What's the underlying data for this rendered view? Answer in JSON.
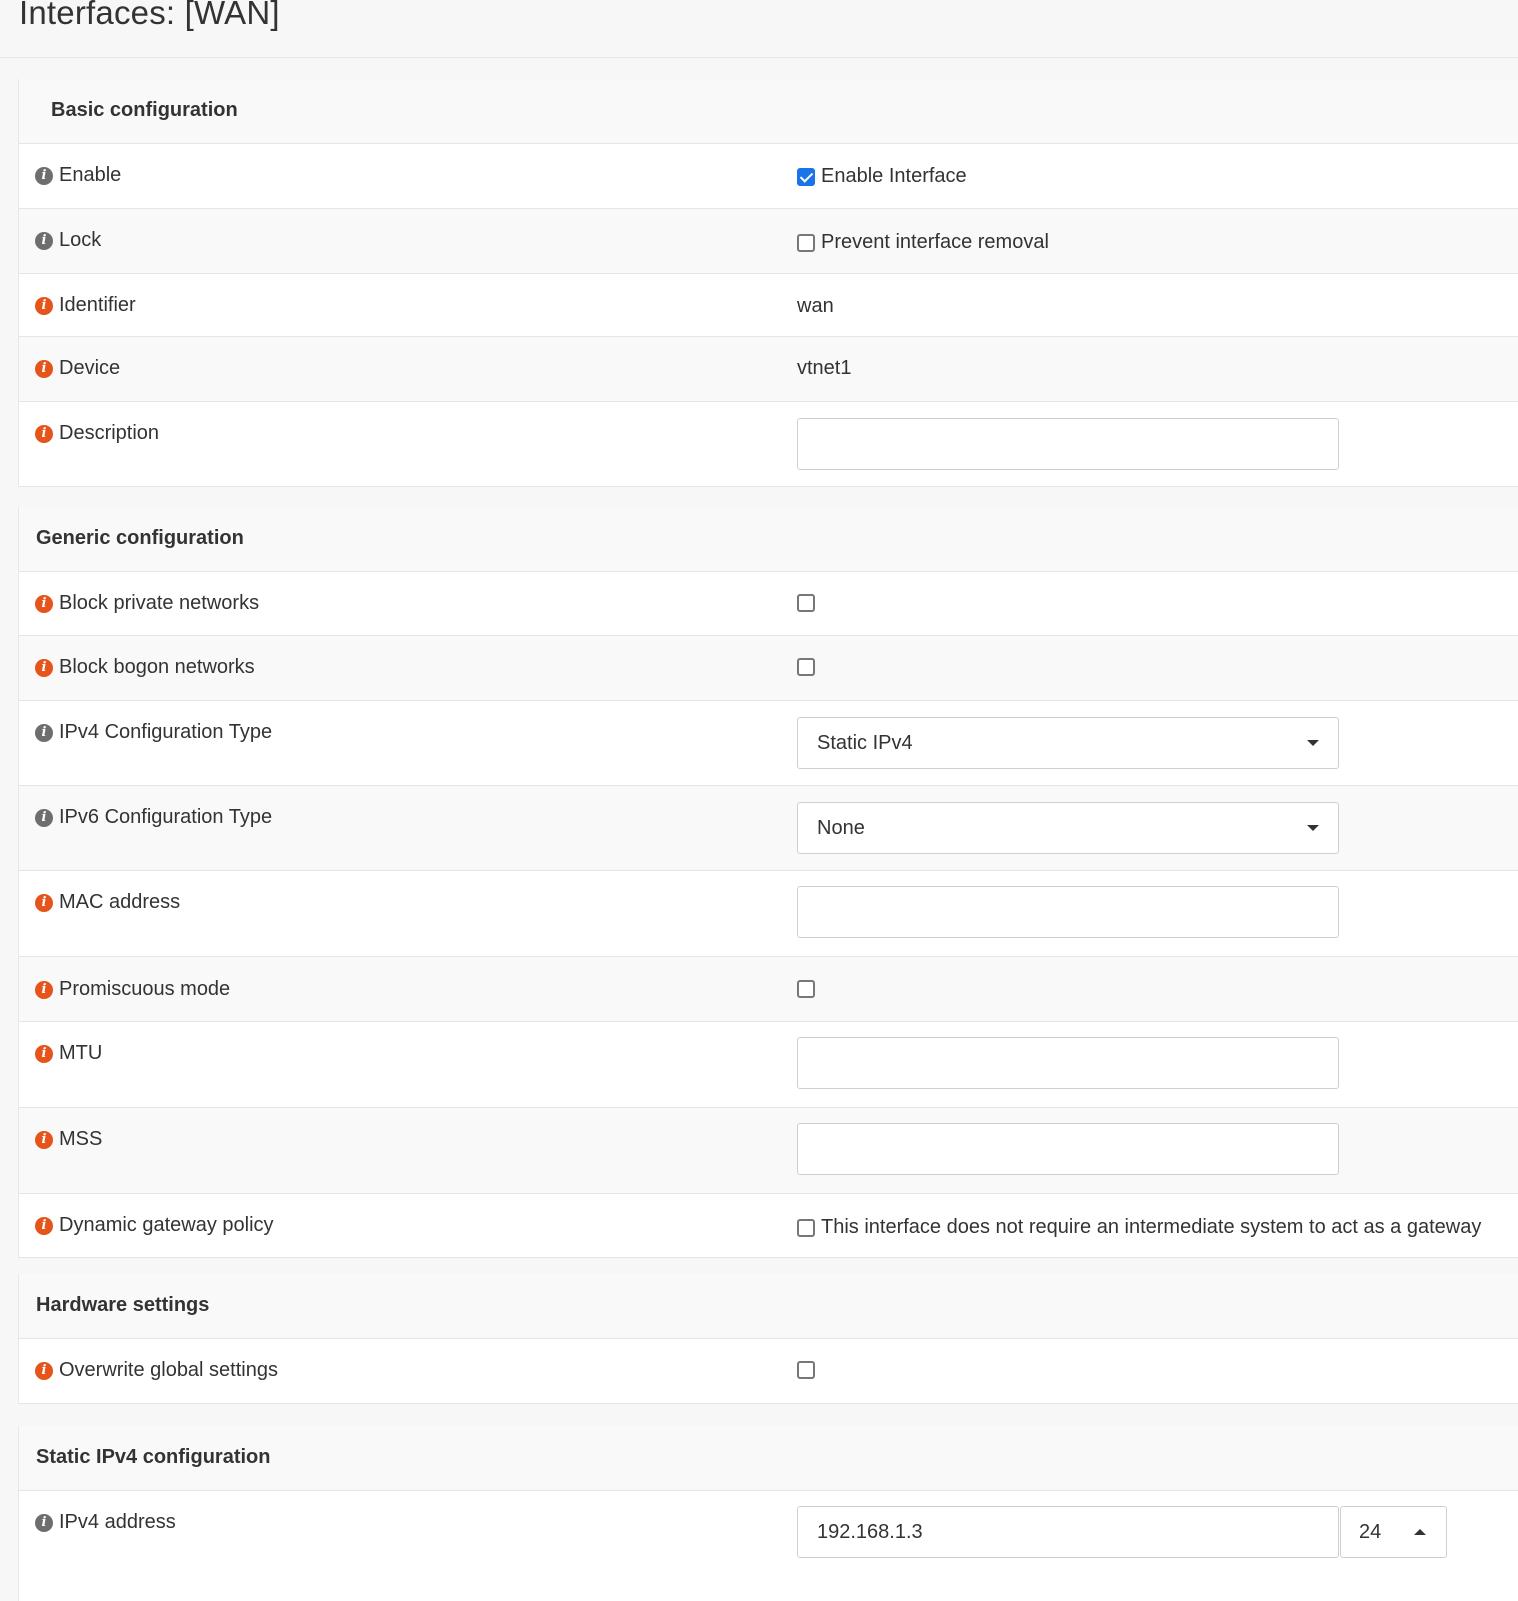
{
  "page": {
    "title": "Interfaces: [WAN]"
  },
  "colors": {
    "info_gray": "#6e6e6e",
    "info_orange": "#e4541b",
    "checkbox_checked": "#1a73e8"
  },
  "basic": {
    "title": "Basic configuration",
    "enable": {
      "label": "Enable",
      "checkbox_label": "Enable Interface",
      "checked": true
    },
    "lock": {
      "label": "Lock",
      "checkbox_label": "Prevent interface removal",
      "checked": false
    },
    "identifier": {
      "label": "Identifier",
      "value": "wan"
    },
    "device": {
      "label": "Device",
      "value": "vtnet1"
    },
    "description": {
      "label": "Description",
      "value": ""
    }
  },
  "generic": {
    "title": "Generic configuration",
    "block_private": {
      "label": "Block private networks",
      "checked": false
    },
    "block_bogon": {
      "label": "Block bogon networks",
      "checked": false
    },
    "ipv4_type": {
      "label": "IPv4 Configuration Type",
      "selected": "Static IPv4"
    },
    "ipv6_type": {
      "label": "IPv6 Configuration Type",
      "selected": "None"
    },
    "mac": {
      "label": "MAC address",
      "value": ""
    },
    "promiscuous": {
      "label": "Promiscuous mode",
      "checked": false
    },
    "mtu": {
      "label": "MTU",
      "value": ""
    },
    "mss": {
      "label": "MSS",
      "value": ""
    },
    "dynamic_gw": {
      "label": "Dynamic gateway policy",
      "checkbox_label": "This interface does not require an intermediate system to act as a gateway",
      "checked": false
    }
  },
  "hardware": {
    "title": "Hardware settings",
    "overwrite": {
      "label": "Overwrite global settings",
      "checked": false
    }
  },
  "static_ipv4": {
    "title": "Static IPv4 configuration",
    "address": {
      "label": "IPv4 address",
      "value": "192.168.1.3",
      "subnet": "24"
    }
  }
}
